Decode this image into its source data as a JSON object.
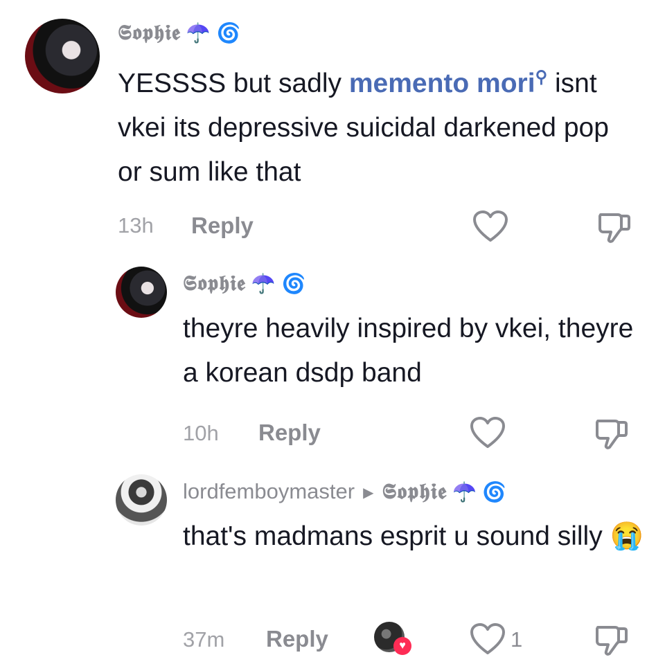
{
  "comments": [
    {
      "username": "𝕾𝖔𝖕𝖍𝖎𝖊",
      "badges": [
        "☂️",
        "🌀"
      ],
      "text_before": "YESSSS but sadly ",
      "link_text": "memento mori",
      "text_after": " isnt vkei its depressive suicidal darkened pop or sum like that",
      "time": "13h",
      "reply_label": "Reply"
    },
    {
      "username": "𝕾𝖔𝖕𝖍𝖎𝖊",
      "badges": [
        "☂️",
        "🌀"
      ],
      "text": "theyre heavily inspired by vkei, theyre a korean dsdp band",
      "time": "10h",
      "reply_label": "Reply"
    },
    {
      "username": "lordfemboymaster",
      "reply_to": "𝕾𝖔𝖕𝖍𝖎𝖊",
      "badges": [
        "☂️",
        "🌀"
      ],
      "text": "that's madmans esprit u sound silly 😭",
      "time": "37m",
      "reply_label": "Reply",
      "like_count": "1"
    }
  ],
  "colors": {
    "text": "#161823",
    "muted": "#8a8b91",
    "link": "#4a6bb5",
    "like_red": "#fe2c55"
  },
  "icons": [
    "search-icon",
    "heart-icon",
    "dislike-icon",
    "caret-right-icon"
  ]
}
